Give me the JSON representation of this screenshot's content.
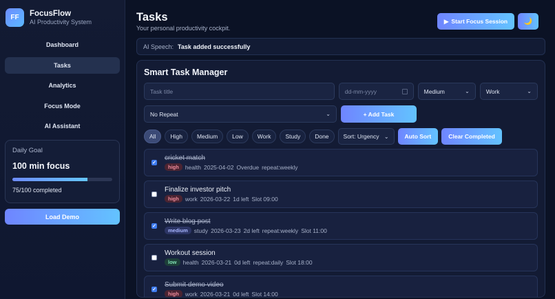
{
  "brand": {
    "logo_text": "FF",
    "name": "FocusFlow",
    "tagline": "AI Productivity System"
  },
  "nav": [
    {
      "label": "Dashboard",
      "active": false
    },
    {
      "label": "Tasks",
      "active": true
    },
    {
      "label": "Analytics",
      "active": false
    },
    {
      "label": "Focus Mode",
      "active": false
    },
    {
      "label": "AI Assistant",
      "active": false
    }
  ],
  "goal": {
    "title": "Daily Goal",
    "value": "100 min focus",
    "progress": 0.75,
    "meta": "75/100 completed"
  },
  "load_demo_label": "Load Demo",
  "header": {
    "title": "Tasks",
    "subtitle": "Your personal productivity cockpit.",
    "focus_button": "Start Focus Session",
    "focus_icon": "▶",
    "theme_icon": "🌙"
  },
  "speech": {
    "label": "AI Speech:",
    "text": "Task added successfully"
  },
  "manager": {
    "title": "Smart Task Manager",
    "title_placeholder": "Task title",
    "date_placeholder": "dd-mm-yyyy",
    "priority_value": "Medium",
    "category_value": "Work",
    "repeat_value": "No Repeat",
    "add_button": "+ Add Task"
  },
  "filters": {
    "chips": [
      "All",
      "High",
      "Medium",
      "Low",
      "Work",
      "Study",
      "Done"
    ],
    "active": "All",
    "sort_value": "Sort: Urgency",
    "auto_sort": "Auto Sort",
    "clear_completed": "Clear Completed"
  },
  "tasks": [
    {
      "title": "cricket match",
      "done": true,
      "priority": "high",
      "category": "health",
      "date": "2025-04-02",
      "status": "Overdue",
      "repeat": "repeat:weekly",
      "slot": ""
    },
    {
      "title": "Finalize investor pitch",
      "done": false,
      "priority": "high",
      "category": "work",
      "date": "2026-03-22",
      "status": "1d left",
      "repeat": "",
      "slot": "Slot 09:00"
    },
    {
      "title": "Write blog post",
      "done": true,
      "priority": "medium",
      "category": "study",
      "date": "2026-03-23",
      "status": "2d left",
      "repeat": "repeat:weekly",
      "slot": "Slot 11:00"
    },
    {
      "title": "Workout session",
      "done": false,
      "priority": "low",
      "category": "health",
      "date": "2026-03-21",
      "status": "0d left",
      "repeat": "repeat:daily",
      "slot": "Slot 18:00"
    },
    {
      "title": "Submit demo video",
      "done": true,
      "priority": "high",
      "category": "work",
      "date": "2026-03-21",
      "status": "0d left",
      "repeat": "",
      "slot": "Slot 14:00"
    }
  ]
}
